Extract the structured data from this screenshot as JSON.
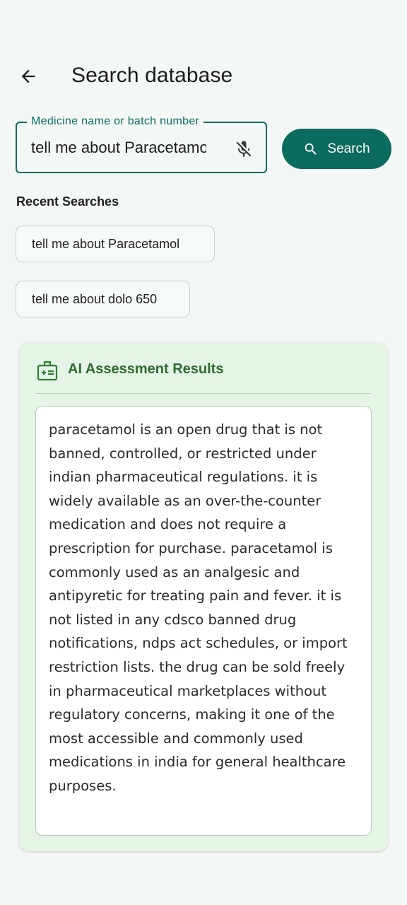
{
  "header": {
    "title": "Search database",
    "back_icon": "arrow-back-icon"
  },
  "search": {
    "label": "Medicine name or batch number",
    "value": "tell me about Paracetamol",
    "mic_icon": "mic-off-icon",
    "button_label": "Search",
    "button_icon": "search-icon",
    "accent_color": "#0c6b5f"
  },
  "recent": {
    "heading": "Recent Searches",
    "items": [
      {
        "label": "tell me about Paracetamol"
      },
      {
        "label": "tell me about dolo 650"
      }
    ]
  },
  "assessment": {
    "icon": "medical-id-icon",
    "title": "AI Assessment Results",
    "title_color": "#2e6b2e",
    "text": "paracetamol is an open drug that is not banned, controlled, or restricted under indian pharmaceutical regulations. it is widely available as an over-the-counter medication and does not require a prescription for purchase. paracetamol is commonly used as an analgesic and antipyretic for treating pain and fever. it is not listed in any cdsco banned drug notifications, ndps act schedules, or import restriction lists. the drug can be sold freely in pharmaceutical marketplaces without regulatory concerns, making it one of the most accessible and commonly used medications in india for general healthcare purposes."
  }
}
